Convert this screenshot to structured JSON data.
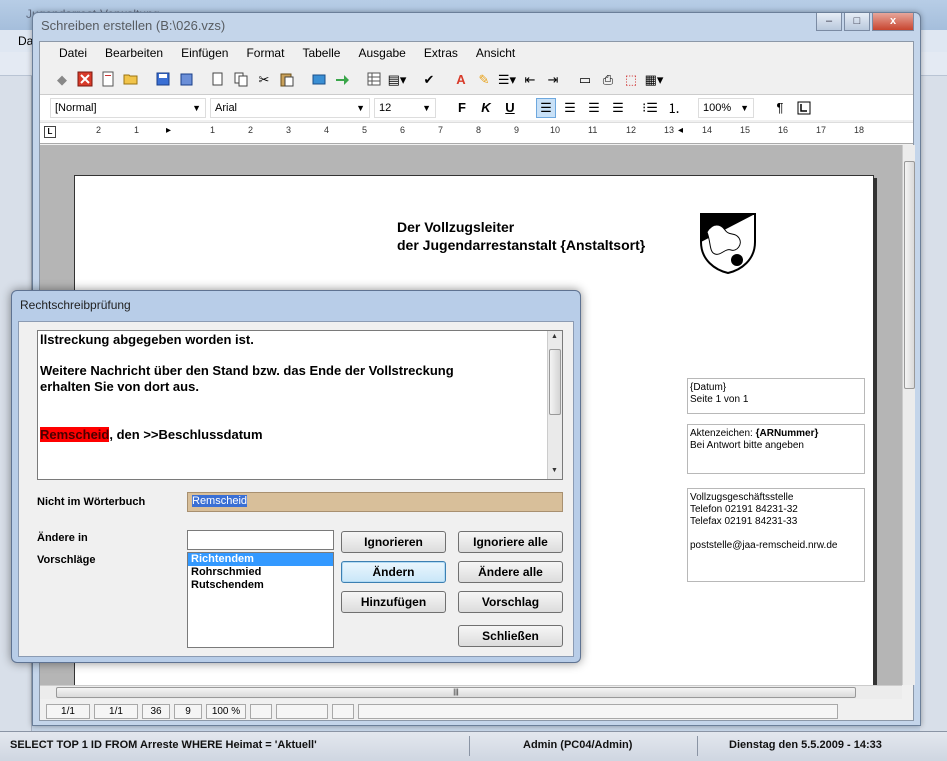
{
  "background_app": {
    "title": "Jugendarrest-Verwaltung",
    "menu_first": "Da"
  },
  "window": {
    "title": "Schreiben erstellen (B:\\026.vzs)",
    "min_label": "–",
    "max_label": "□",
    "close_label": "x"
  },
  "menu": {
    "items": [
      "Datei",
      "Bearbeiten",
      "Einfügen",
      "Format",
      "Tabelle",
      "Ausgabe",
      "Extras",
      "Ansicht"
    ]
  },
  "format_bar": {
    "style_value": "[Normal]",
    "font_value": "Arial",
    "size_value": "12",
    "bold_label": "F",
    "italic_label": "K",
    "underline_label": "U",
    "zoom_value": "100%",
    "pilcrow": "¶"
  },
  "ruler": {
    "marks": [
      "2",
      "1",
      "1",
      "2",
      "3",
      "4",
      "5",
      "6",
      "7",
      "8",
      "9",
      "10",
      "11",
      "12",
      "13",
      "14",
      "15",
      "16",
      "17",
      "18"
    ]
  },
  "document": {
    "header_line1": "Der Vollzugsleiter",
    "header_line2": "der Jugendarrestanstalt {Anstaltsort}",
    "box1_line1": "{Datum}",
    "box1_line2": "Seite 1 von 1",
    "box2_prefix": "Aktenzeichen: ",
    "box2_field": "{ARNummer}",
    "box2_line2": "Bei Antwort bitte angeben",
    "box3_line1": "Vollzugsgeschäftsstelle",
    "box3_line2": "Telefon 02191 84231-32",
    "box3_line3": "Telefax 02191 84231-33",
    "box3_line4": "poststelle@jaa-remscheid.nrw.de"
  },
  "doc_status": {
    "cells": [
      "1/1",
      "1/1",
      "36",
      "9",
      "100 %",
      "",
      "",
      ""
    ]
  },
  "app_status": {
    "query": "SELECT TOP 1 ID FROM Arreste WHERE Heimat = 'Aktuell'",
    "user": "Admin (PC04/Admin)",
    "date": "Dienstag den 5.5.2009 - 14:33"
  },
  "spell_dialog": {
    "title": "Rechtschreibprüfung",
    "context_line1": "llstreckung abgegeben worden ist.",
    "context_line2": "Weitere Nachricht über den Stand bzw. das Ende der Vollstreckung",
    "context_line3": "erhalten Sie von dort aus.",
    "context_error_word": "Remscheid",
    "context_line4_rest": ", den >>Beschlussdatum",
    "label_not_in_dict": "Nicht im Wörterbuch",
    "not_in_dict_value": "Remscheid",
    "label_change_to": "Ändere in",
    "change_to_value": "",
    "label_suggestions": "Vorschläge",
    "suggestions": [
      "Richtendem",
      "Rohrschmied",
      "Rutschendem"
    ],
    "btn_ignore": "Ignorieren",
    "btn_ignore_all": "Ignoriere alle",
    "btn_change": "Ändern",
    "btn_change_all": "Ändere alle",
    "btn_add": "Hinzufügen",
    "btn_suggest": "Vorschlag",
    "btn_close": "Schließen"
  }
}
